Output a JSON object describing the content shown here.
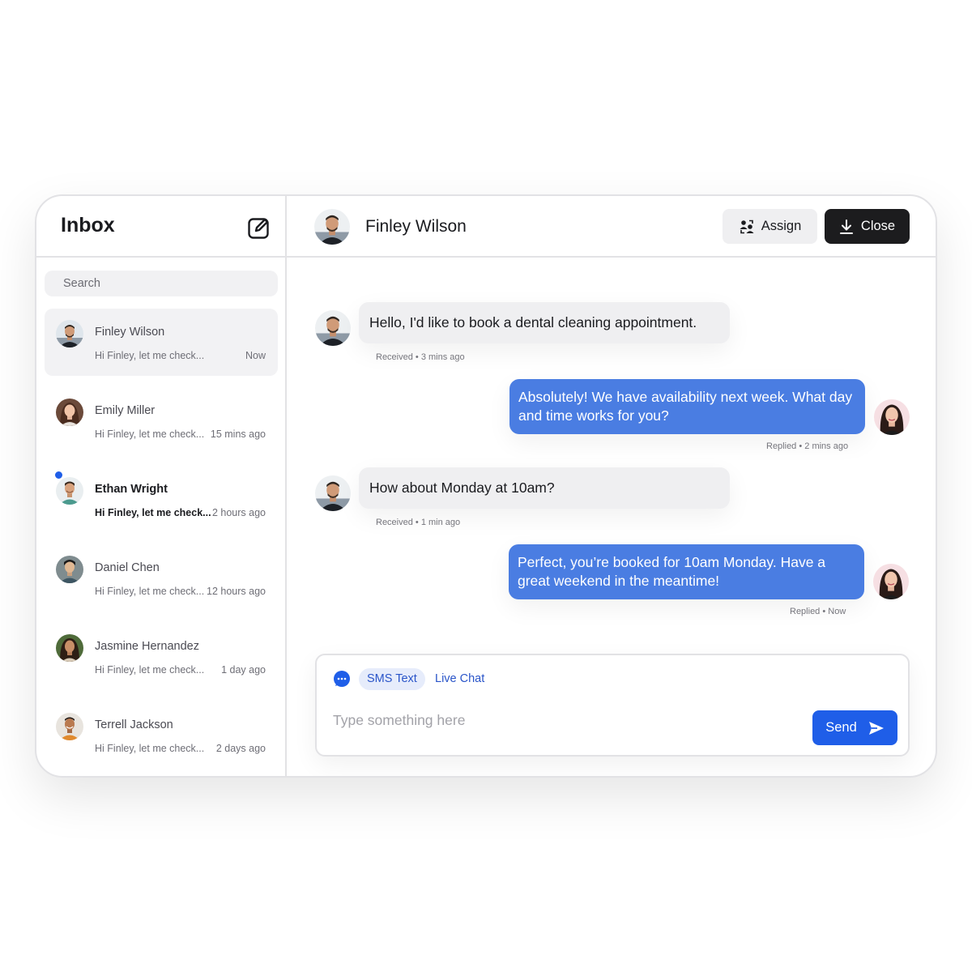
{
  "sidebar": {
    "title": "Inbox",
    "compose_icon": "compose-icon",
    "search_placeholder": "Search",
    "conversations": [
      {
        "name": "Finley Wilson",
        "preview": "Hi Finley, let me check...",
        "time": "Now",
        "active": true,
        "unread": false
      },
      {
        "name": "Emily Miller",
        "preview": "Hi Finley, let me check...",
        "time": "15 mins ago",
        "active": false,
        "unread": false
      },
      {
        "name": "Ethan Wright",
        "preview": "Hi Finley, let me check...",
        "time": "2 hours ago",
        "active": false,
        "unread": true
      },
      {
        "name": "Daniel Chen",
        "preview": "Hi Finley, let me check...",
        "time": "12 hours ago",
        "active": false,
        "unread": false
      },
      {
        "name": "Jasmine Hernandez",
        "preview": "Hi Finley, let me check...",
        "time": "1 day ago",
        "active": false,
        "unread": false
      },
      {
        "name": "Terrell Jackson",
        "preview": "Hi Finley, let me check...",
        "time": "2 days ago",
        "active": false,
        "unread": false
      }
    ]
  },
  "header": {
    "contact_name": "Finley Wilson",
    "assign_label": "Assign",
    "close_label": "Close"
  },
  "messages": [
    {
      "direction": "in",
      "text": "Hello, I'd like to book a dental cleaning appointment.",
      "meta": "Received • 3 mins ago"
    },
    {
      "direction": "out",
      "text": "Absolutely! We have availability next week. What day and time works for you?",
      "meta": "Replied • 2 mins ago"
    },
    {
      "direction": "in",
      "text": "How about Monday at 10am?",
      "meta": "Received • 1 min ago"
    },
    {
      "direction": "out",
      "text": "Perfect, you’re booked for 10am Monday. Have a great weekend in the meantime!",
      "meta": "Replied • Now"
    }
  ],
  "composer": {
    "channels": [
      "SMS Text",
      "Live Chat"
    ],
    "selected_channel": "SMS Text",
    "placeholder": "Type something here",
    "send_label": "Send"
  },
  "colors": {
    "accent": "#1f5ee8",
    "outgoing_bubble": "#4a7de2",
    "incoming_bubble": "#efeff1",
    "close_button": "#1c1c1e"
  }
}
